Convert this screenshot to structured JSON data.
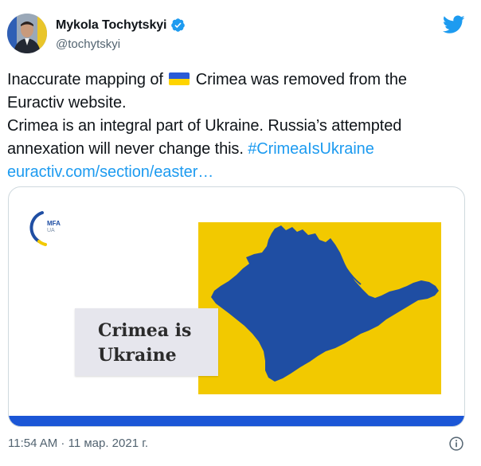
{
  "author": {
    "display_name": "Mykola Tochytskyi",
    "handle": "@tochytskyi",
    "verified": true
  },
  "tweet": {
    "line1_prefix": "Inaccurate mapping of",
    "line1_suffix": "Crimea was removed from the",
    "line2": "Euractiv website.",
    "line3": "Crimea is an integral part of Ukraine. Russia’s attempted",
    "line4_text": "annexation will never change this.",
    "hashtag": "#CrimeaIsUkraine",
    "link": "euractiv.com/section/easter…",
    "timestamp": "11:54 AM · 11 мар. 2021 г."
  },
  "media": {
    "logo_text": "MFA",
    "logo_sub": "UA",
    "caption_line1": "Crimea is",
    "caption_line2": "Ukraine"
  },
  "icons": {
    "brand": "twitter-bird-icon",
    "verified": "verified-badge-icon",
    "info": "info-icon",
    "flag": "ukraine-flag-icon"
  },
  "colors": {
    "link": "#1d9bf0",
    "map_yellow": "#f2c900",
    "map_blue": "#1f4ea3",
    "band_blue": "#1b56d6"
  }
}
